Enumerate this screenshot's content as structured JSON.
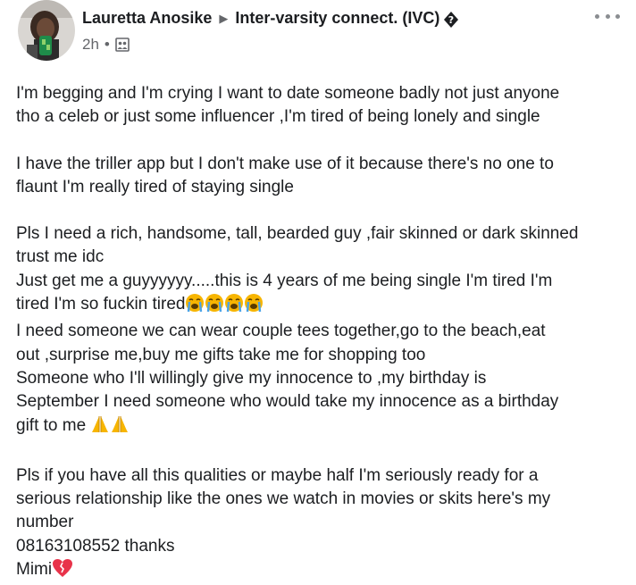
{
  "post": {
    "author": "Lauretta Anosike",
    "group": "Inter-varsity connect. (IVC)",
    "time": "2h",
    "separator": "•",
    "audience_icon": "group-audience-icon",
    "arrow_icon": "right-arrow-icon",
    "group_badge_icon": "replacement-glyph-icon",
    "more_icon": "more-options-icon"
  },
  "content": {
    "p1": [
      "I'm begging and I'm crying I want to date someone badly not just anyone",
      "tho a celeb or just some influencer ,I'm tired of being lonely and single"
    ],
    "p2": [
      "I have the triller app but I don't make use of it because there's no one to",
      "flaunt I'm really tired of staying single"
    ],
    "p3": [
      "Pls I need a rich, handsome, tall, bearded guy ,fair skinned or dark skinned",
      "trust me idc",
      "Just get me a guyyyyyy.....this is 4 years of me being single I'm tired I'm",
      "tired I'm so fuckin tired",
      "I need someone we can wear couple tees together,go to the beach,eat",
      "out ,surprise me,buy me gifts take me for shopping too",
      "Someone who I'll willingly give my innocence to ,my birthday is",
      "September I need someone who would take my innocence as a birthday",
      "gift to me"
    ],
    "p4": [
      "Pls if you have all this qualities or maybe half I'm seriously ready for a",
      "serious relationship like the ones we watch in movies or skits here's my",
      "number",
      "08163108552 thanks",
      "Mimi"
    ]
  },
  "emojis": {
    "crying": [
      "loudly-crying-face-icon",
      "loudly-crying-face-icon",
      "loudly-crying-face-icon",
      "loudly-crying-face-icon"
    ],
    "pray": [
      "folded-hands-icon",
      "folded-hands-icon"
    ],
    "heart": "mending-heart-icon"
  },
  "colors": {
    "text": "#1c1e21",
    "meta": "#65676b",
    "emoji_yellow": "#f7b500",
    "heart_red": "#e8334a"
  }
}
